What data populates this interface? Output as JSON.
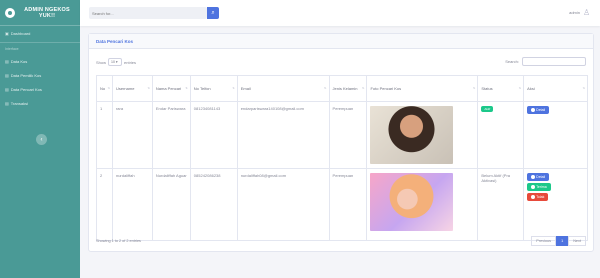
{
  "sidebar": {
    "brand": "ADMIN NGEKOS YUK!!",
    "dashboard": "Dashboard",
    "section": "Interface",
    "items": [
      "Data Kos",
      "Data Pemilik Kos",
      "Data Pencari Kos",
      "Transaksi"
    ],
    "toggle_icon": "chevron-left-icon"
  },
  "topbar": {
    "search_placeholder": "Search for...",
    "user": "admin"
  },
  "card": {
    "title": "Data Pencari Kos",
    "show_label": "Show",
    "entries_value": "10",
    "entries_label": "entries",
    "search_label": "Search:"
  },
  "table": {
    "headers": [
      "No",
      "Username",
      "Nama Pencari",
      "No Telfon",
      "Email",
      "Jenis Kelamin",
      "Foto Pencari Kos",
      "Status",
      "Aksi"
    ],
    "rows": [
      {
        "no": "1",
        "username": "rara",
        "nama": "Endar Pariswara",
        "telp": "081234081143",
        "email": "endarpariswara140108@gmail.com",
        "gender": "Perempuan",
        "status": "Aktif",
        "actions": [
          "Detail"
        ]
      },
      {
        "no": "2",
        "username": "nurdaliffah",
        "nama": "Nurdaliffah Aguar",
        "telp": "085242086238",
        "email": "nurdaliffah08@gmail.com",
        "gender": "Perempuan",
        "status": "Belum Aktif (Pra Aktivasi)",
        "actions": [
          "Detail",
          "Terima",
          "Tolak"
        ]
      }
    ]
  },
  "footer": {
    "info": "Showing 1 to 2 of 2 entries",
    "previous": "Previous",
    "page": "1",
    "next": "Next"
  }
}
